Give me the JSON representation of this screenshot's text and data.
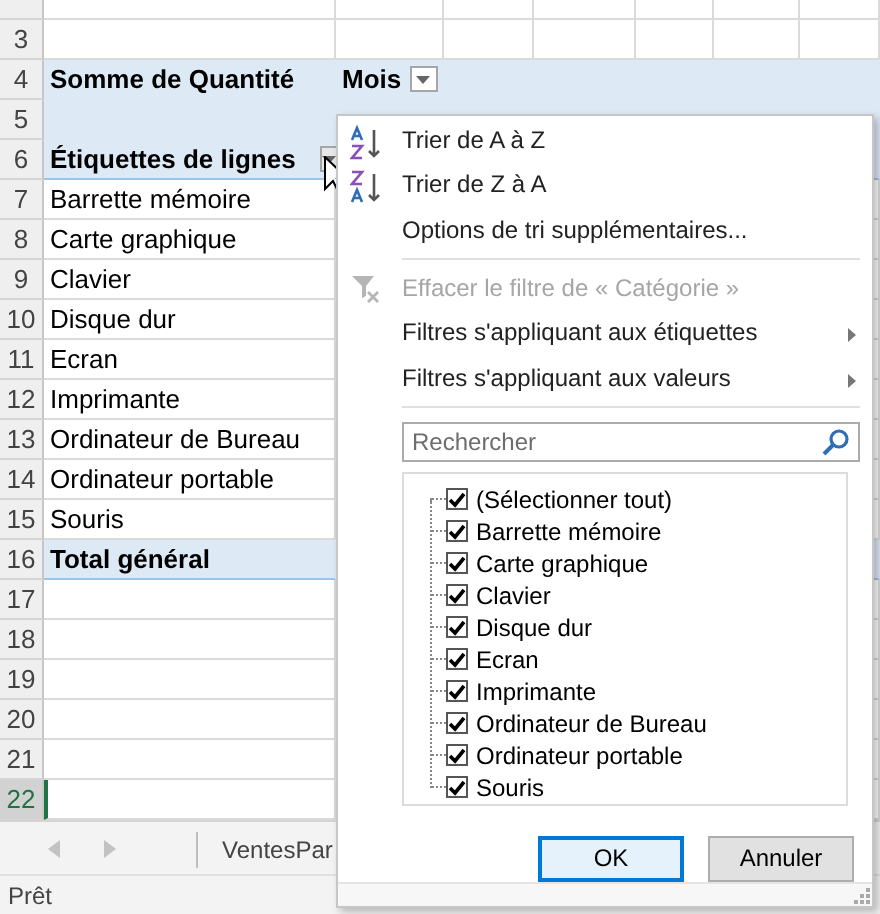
{
  "sheet": {
    "rows": [
      {
        "kind": "blank",
        "selected": false
      },
      {
        "number": "3",
        "kind": "blank",
        "selected": false
      },
      {
        "number": "4",
        "kind": "header",
        "label": "Somme de Quantité",
        "column_field": "Mois",
        "selected": false
      },
      {
        "number": "5",
        "kind": "band",
        "selected": false
      },
      {
        "number": "6",
        "kind": "row_labels",
        "label": "Étiquettes de lignes",
        "selected": false
      },
      {
        "number": "7",
        "kind": "item",
        "label": "Barrette mémoire",
        "selected": false
      },
      {
        "number": "8",
        "kind": "item",
        "label": "Carte graphique",
        "selected": false
      },
      {
        "number": "9",
        "kind": "item",
        "label": "Clavier",
        "selected": false
      },
      {
        "number": "10",
        "kind": "item",
        "label": "Disque dur",
        "selected": false
      },
      {
        "number": "11",
        "kind": "item",
        "label": "Ecran",
        "selected": false
      },
      {
        "number": "12",
        "kind": "item",
        "label": "Imprimante",
        "selected": false
      },
      {
        "number": "13",
        "kind": "item",
        "label": "Ordinateur de Bureau",
        "selected": false
      },
      {
        "number": "14",
        "kind": "item",
        "label": "Ordinateur portable",
        "selected": false
      },
      {
        "number": "15",
        "kind": "item",
        "label": "Souris",
        "selected": false
      },
      {
        "number": "16",
        "kind": "total",
        "label": "Total général",
        "selected": false
      },
      {
        "number": "17",
        "kind": "blank",
        "selected": false
      },
      {
        "number": "18",
        "kind": "blank",
        "selected": false
      },
      {
        "number": "19",
        "kind": "blank",
        "selected": false
      },
      {
        "number": "20",
        "kind": "blank",
        "selected": false
      },
      {
        "number": "21",
        "kind": "blank",
        "selected": false
      },
      {
        "number": "22",
        "kind": "blank",
        "selected": true
      }
    ]
  },
  "filter_menu": {
    "items": [
      {
        "kind": "sort_asc",
        "label": "Trier de A à Z",
        "disabled": false
      },
      {
        "kind": "sort_desc",
        "label": "Trier de Z à A",
        "disabled": false
      },
      {
        "kind": "plain",
        "label": "Options de tri supplémentaires...",
        "disabled": false
      },
      {
        "kind": "separator"
      },
      {
        "kind": "clear_filter",
        "label": "Effacer le filtre de « Catégorie »",
        "disabled": true
      },
      {
        "kind": "submenu",
        "label": "Filtres s'appliquant aux étiquettes",
        "disabled": false
      },
      {
        "kind": "submenu",
        "label": "Filtres s'appliquant aux valeurs",
        "disabled": false
      },
      {
        "kind": "separator"
      }
    ],
    "search": {
      "placeholder": "Rechercher"
    },
    "checklist": [
      {
        "label": "(Sélectionner tout)",
        "checked": true
      },
      {
        "label": "Barrette mémoire",
        "checked": true
      },
      {
        "label": "Carte graphique",
        "checked": true
      },
      {
        "label": "Clavier",
        "checked": true
      },
      {
        "label": "Disque dur",
        "checked": true
      },
      {
        "label": "Ecran",
        "checked": true
      },
      {
        "label": "Imprimante",
        "checked": true
      },
      {
        "label": "Ordinateur de Bureau",
        "checked": true
      },
      {
        "label": "Ordinateur portable",
        "checked": true
      },
      {
        "label": "Souris",
        "checked": true
      }
    ],
    "buttons": [
      {
        "label": "OK",
        "default": true
      },
      {
        "label": "Annuler",
        "default": false
      }
    ]
  },
  "sheet_tabs": [
    {
      "label": "VentesPar"
    }
  ],
  "status_bar": {
    "text": "Prêt"
  }
}
